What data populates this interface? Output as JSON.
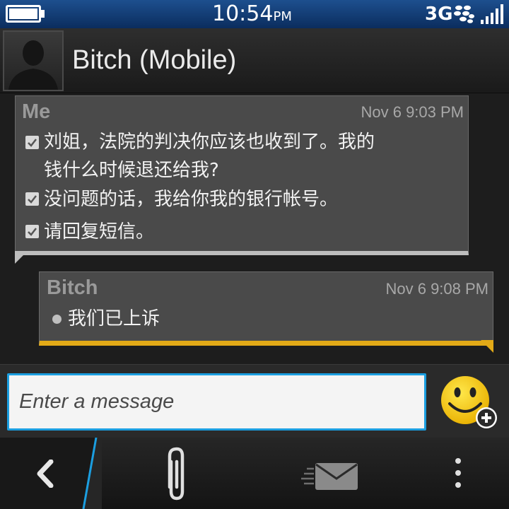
{
  "status": {
    "time": "10:54",
    "ampm": "PM",
    "network": "3G"
  },
  "header": {
    "contact_name": "Bitch (Mobile)"
  },
  "messages": [
    {
      "sender": "Me",
      "timestamp": "Nov 6 9:03 PM",
      "lines": [
        "刘姐，法院的判决你应该也收到了。我的",
        "钱什么时候退还给我?",
        "没问题的话，我给你我的银行帐号。",
        "请回复短信。"
      ],
      "accent": "#bdbdbd"
    },
    {
      "sender": "Bitch",
      "timestamp": "Nov 6 9:08 PM",
      "lines": [
        "我们已上诉"
      ],
      "accent": "#e3aa17"
    }
  ],
  "composer": {
    "placeholder": "Enter a message"
  },
  "colors": {
    "status_bar": "#0b2d5e",
    "input_focus": "#1b9ee0",
    "incoming_accent": "#e3aa17"
  },
  "icons": [
    "battery-icon",
    "blackberry-logo-icon",
    "signal-icon",
    "avatar-silhouette-icon",
    "checkmark-icon",
    "emoji-add-icon",
    "back-icon",
    "paperclip-icon",
    "send-mail-icon",
    "more-icon"
  ]
}
